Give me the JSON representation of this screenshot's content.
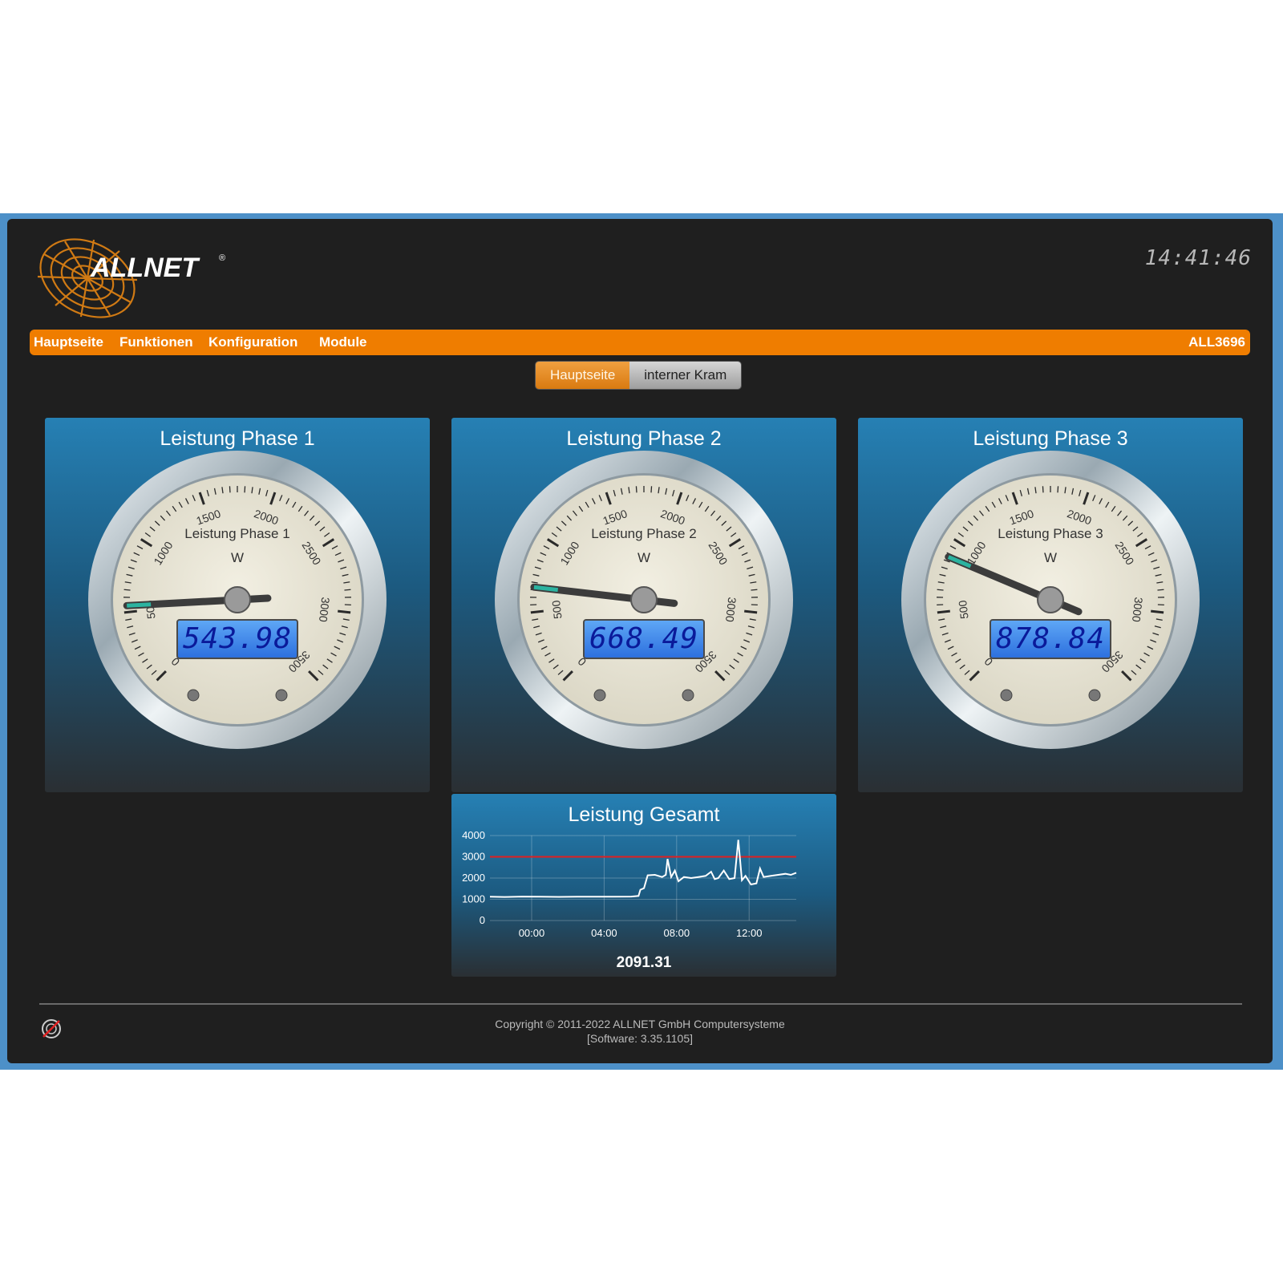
{
  "header": {
    "logo_text": "ALLNET",
    "clock": "14:41:46"
  },
  "nav": {
    "items": [
      {
        "label": "Hauptseite"
      },
      {
        "label": "Funktionen"
      },
      {
        "label": "Konfiguration"
      },
      {
        "label": "Module"
      }
    ],
    "device": "ALL3696"
  },
  "subtabs": {
    "active": "Hauptseite",
    "inactive": "interner Kram"
  },
  "gauges": [
    {
      "title": "Leistung Phase 1",
      "inner_label": "Leistung Phase 1",
      "unit": "W",
      "value": "543.98",
      "reading": 543.98
    },
    {
      "title": "Leistung Phase 2",
      "inner_label": "Leistung Phase 2",
      "unit": "W",
      "value": "668.49",
      "reading": 668.49
    },
    {
      "title": "Leistung Phase 3",
      "inner_label": "Leistung Phase 3",
      "unit": "W",
      "value": "878.84",
      "reading": 878.84
    }
  ],
  "gauge_scale": {
    "min": 0,
    "max": 3500,
    "ticks": [
      "0",
      "500",
      "1000",
      "1500",
      "2000",
      "2500",
      "3000",
      "3500"
    ]
  },
  "total": {
    "title": "Leistung Gesamt",
    "value": "2091.31"
  },
  "chart_data": {
    "type": "line",
    "title": "Leistung Gesamt",
    "xlabel": "",
    "ylabel": "",
    "x_ticks": [
      "00:00",
      "04:00",
      "08:00",
      "12:00"
    ],
    "y_ticks": [
      "0",
      "1000",
      "2000",
      "3000",
      "4000"
    ],
    "xlim": [
      -2.3,
      14.6
    ],
    "ylim": [
      0,
      4000
    ],
    "threshold": 3000,
    "colors": {
      "line": "#ffffff",
      "threshold": "#e02020"
    },
    "series": [
      {
        "x": [
          -2.3,
          -1.5,
          -0.5,
          0.5,
          1.5,
          2.5,
          3.5,
          4.5,
          5.5,
          5.9,
          6.0,
          6.2,
          6.4,
          6.8,
          7.2,
          7.4,
          7.5,
          7.7,
          7.9,
          8.1,
          8.4,
          8.8,
          9.2,
          9.6,
          9.9,
          10.1,
          10.3,
          10.6,
          10.9,
          11.2,
          11.4,
          11.6,
          11.8,
          12.1,
          12.4,
          12.6,
          12.8,
          13.2,
          13.6,
          14.0,
          14.3,
          14.6
        ],
        "y": [
          1120,
          1110,
          1130,
          1120,
          1115,
          1125,
          1120,
          1125,
          1130,
          1160,
          1450,
          1520,
          2130,
          2150,
          2050,
          2150,
          2900,
          2050,
          2350,
          1850,
          2050,
          2000,
          2050,
          2100,
          2300,
          1950,
          2000,
          2350,
          1950,
          2000,
          3800,
          1900,
          2100,
          1700,
          1750,
          2450,
          2050,
          2100,
          2150,
          2200,
          2150,
          2250
        ]
      }
    ]
  },
  "footer": {
    "copyright": "Copyright © 2011-2022 ALLNET GmbH Computersysteme",
    "software": "[Software: 3.35.1105]"
  }
}
